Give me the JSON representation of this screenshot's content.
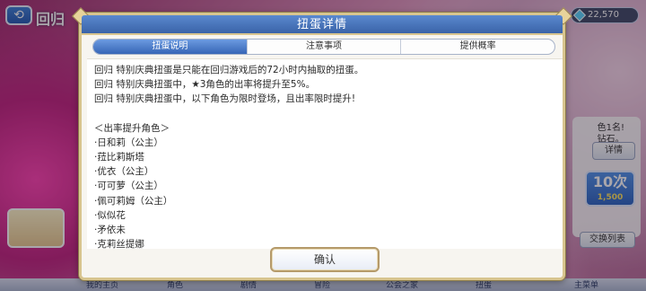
{
  "background": {
    "back_icon": "back-arrow-icon",
    "title": "回归",
    "currency_value": "22,570",
    "side_text_line1": "色1名!",
    "side_text_line2": "钻石。",
    "detail_label": "详情",
    "ten_pull_label": "10次",
    "ten_pull_cost": "1,500",
    "exchange_label": "交换列表",
    "nav_items": [
      "我的主页",
      "角色",
      "剧情",
      "冒险",
      "公会之家",
      "扭蛋",
      "主菜单"
    ]
  },
  "dialog": {
    "title": "扭蛋详情",
    "tabs": [
      {
        "label": "扭蛋说明",
        "active": true
      },
      {
        "label": "注意事项",
        "active": false
      },
      {
        "label": "提供概率",
        "active": false
      }
    ],
    "description_lines": [
      "回归 特别庆典扭蛋是只能在回归游戏后的72小时内抽取的扭蛋。",
      "回归 特别庆典扭蛋中，★3角色的出率将提升至5%。",
      "回归 特别庆典扭蛋中，以下角色为限时登场，且出率限时提升!"
    ],
    "rateup_header": "＜出率提升角色＞",
    "rateup_characters": [
      "·日和莉（公主）",
      "·菈比莉斯塔",
      "·优衣（公主）",
      "·可可萝（公主）",
      "·佩可莉姆（公主）",
      "·似似花",
      "·矛依未",
      "·克莉丝提娜"
    ],
    "confirm_label": "确认"
  },
  "colors": {
    "header_blue": "#3a63a8",
    "frame_gold": "#d8c58f",
    "tab_active": "#3766b6"
  }
}
